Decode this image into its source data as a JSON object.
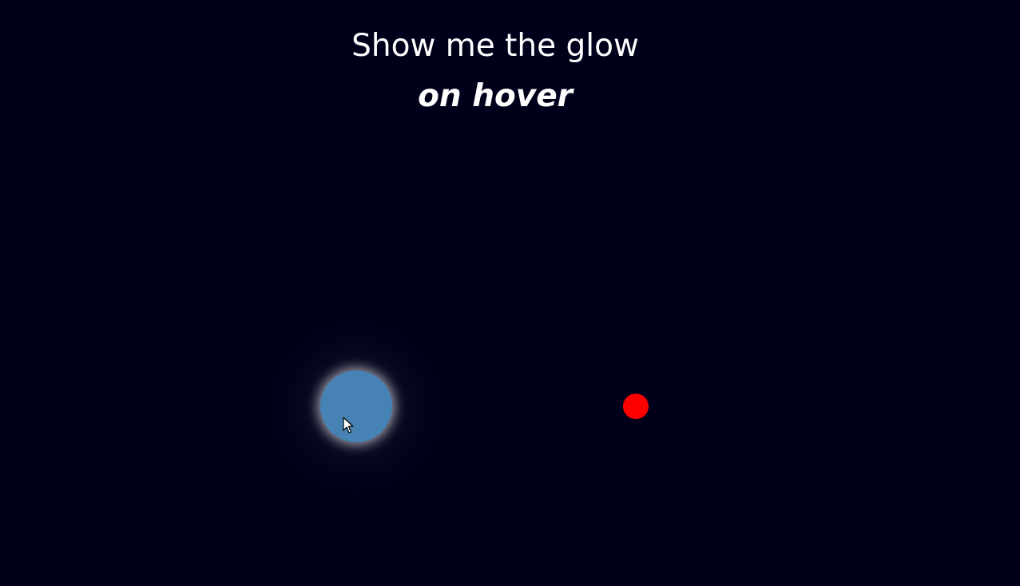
{
  "heading": {
    "main": "Show me the glow",
    "sub": "on hover"
  },
  "colors": {
    "background": "#00001a",
    "text": "#ffffff",
    "glow_circle_fill": "#4682b4",
    "glow_color": "#ffffff",
    "red_dot_fill": "#ff0000"
  },
  "elements": {
    "glow_circle": {
      "state": "hovered"
    },
    "red_dot": {
      "state": "normal"
    }
  },
  "icons": {
    "cursor": "mouse-pointer-icon"
  }
}
